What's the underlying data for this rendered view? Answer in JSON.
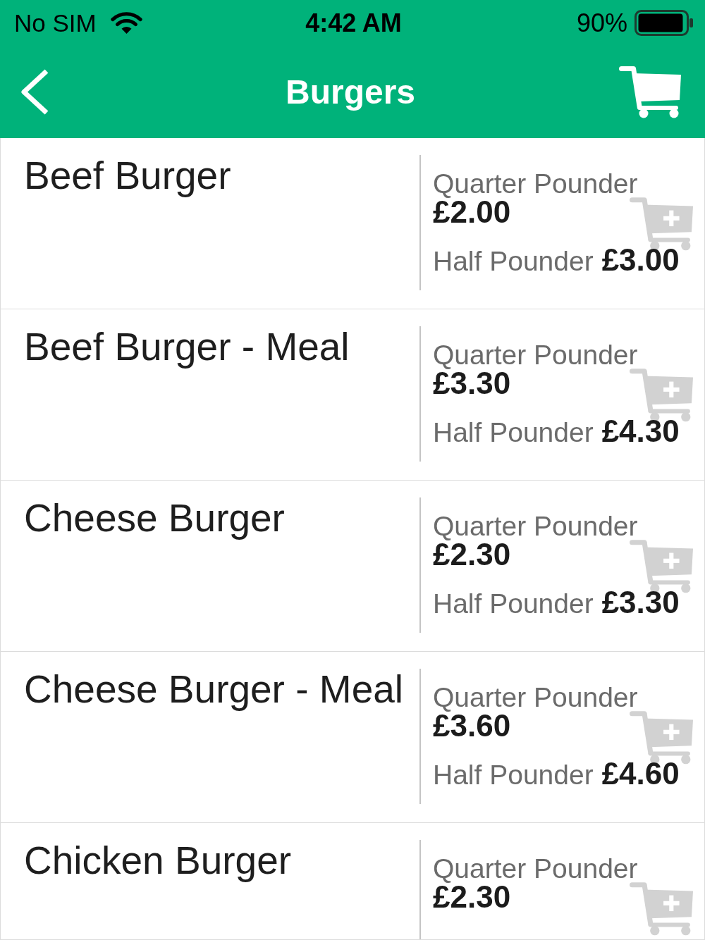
{
  "status_bar": {
    "carrier": "No SIM",
    "time": "4:42 AM",
    "battery": "90%"
  },
  "header": {
    "title": "Burgers"
  },
  "items": [
    {
      "name": "Beef Burger",
      "options": [
        {
          "size": "Quarter Pounder",
          "price": "£2.00"
        },
        {
          "size": "Half Pounder",
          "price": "£3.00"
        }
      ]
    },
    {
      "name": "Beef Burger - Meal",
      "options": [
        {
          "size": "Quarter Pounder",
          "price": "£3.30"
        },
        {
          "size": "Half Pounder",
          "price": "£4.30"
        }
      ]
    },
    {
      "name": "Cheese Burger",
      "options": [
        {
          "size": "Quarter Pounder",
          "price": "£2.30"
        },
        {
          "size": "Half Pounder",
          "price": "£3.30"
        }
      ]
    },
    {
      "name": "Cheese Burger - Meal",
      "options": [
        {
          "size": "Quarter Pounder",
          "price": "£3.60"
        },
        {
          "size": "Half Pounder",
          "price": "£4.60"
        }
      ]
    },
    {
      "name": "Chicken Burger",
      "options": [
        {
          "size": "Quarter Pounder",
          "price": "£2.30"
        }
      ]
    }
  ]
}
